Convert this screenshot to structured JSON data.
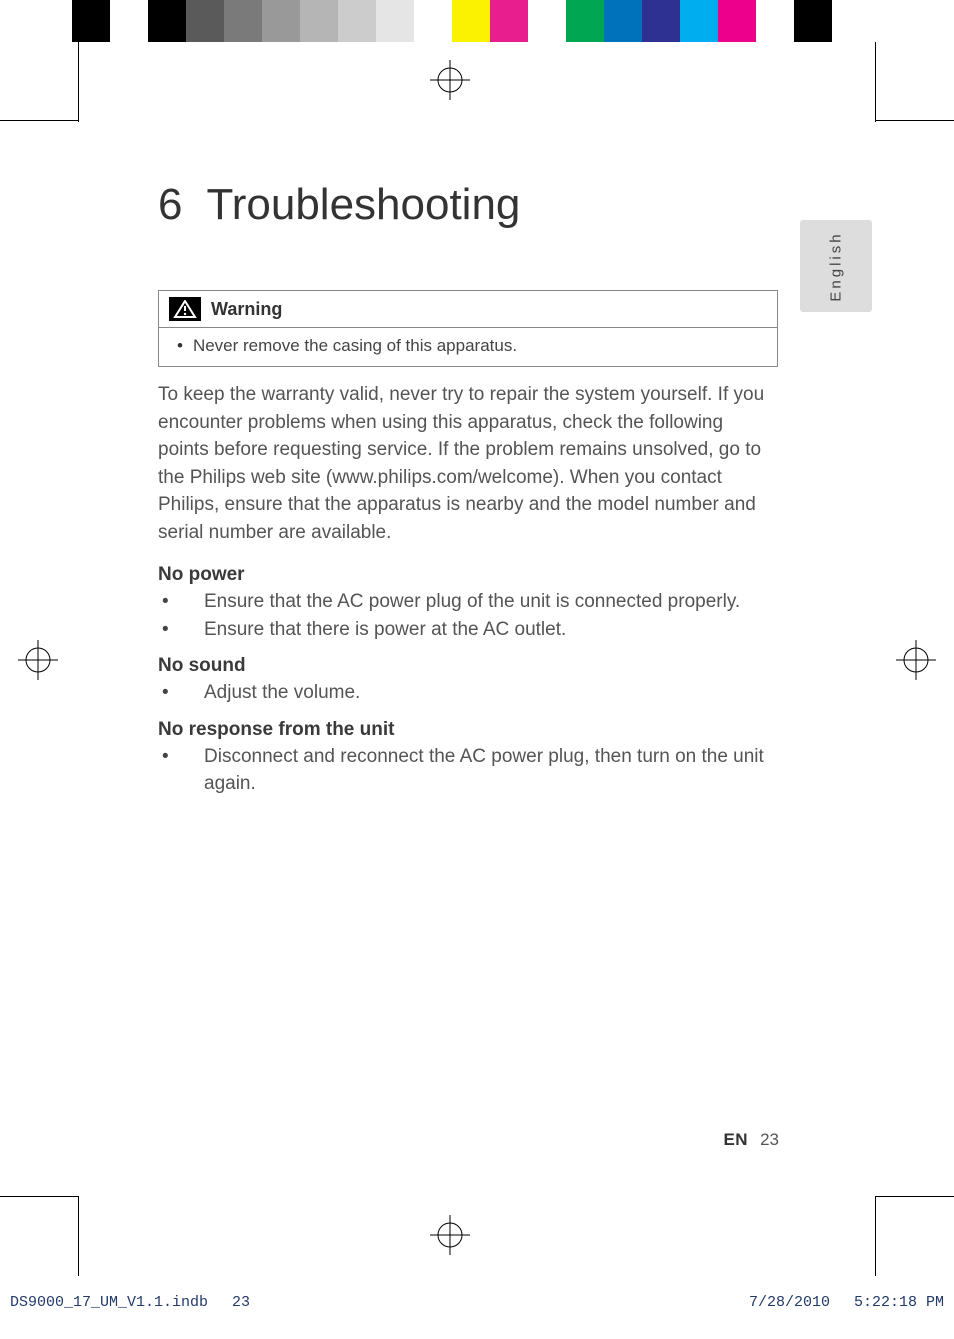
{
  "chapter": {
    "number": "6",
    "title": "Troubleshooting"
  },
  "warning": {
    "label": "Warning",
    "text": "Never remove the casing of this apparatus."
  },
  "intro": "To keep the warranty valid, never try to repair the system yourself. If you encounter problems when using this apparatus, check the following points before requesting service. If the problem remains unsolved, go to the Philips web site (www.philips.com/welcome). When you contact Philips, ensure that the apparatus is nearby and the model number and serial number are available.",
  "sections": [
    {
      "heading": "No power",
      "items": [
        "Ensure that the AC power plug of the unit is connected properly.",
        "Ensure that there is power at the AC outlet."
      ]
    },
    {
      "heading": "No sound",
      "items": [
        "Adjust the volume."
      ]
    },
    {
      "heading": "No response from the unit",
      "items": [
        "Disconnect and reconnect the AC power plug, then turn on the unit again."
      ]
    }
  ],
  "language_tab": "English",
  "footer": {
    "lang": "EN",
    "page": "23"
  },
  "file_info": {
    "filename": "DS9000_17_UM_V1.1.indb",
    "page": "23",
    "date": "7/28/2010",
    "time": "5:22:18 PM"
  }
}
